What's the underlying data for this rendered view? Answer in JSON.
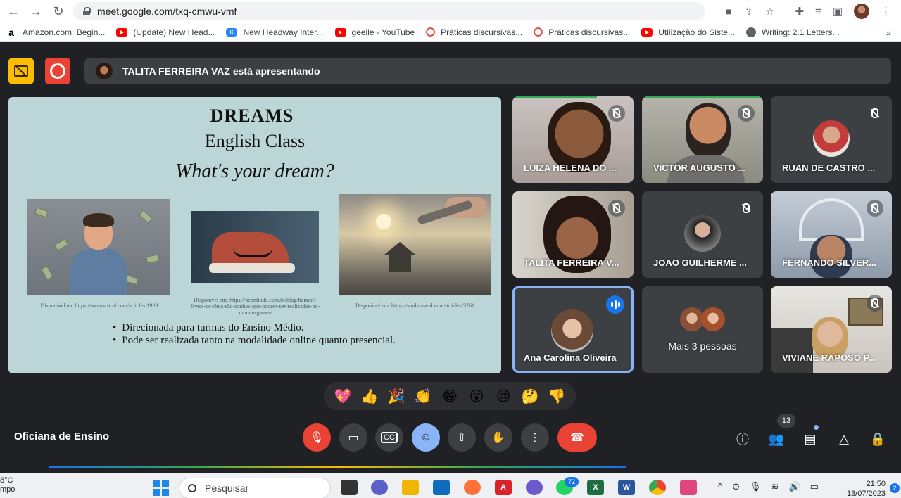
{
  "browser": {
    "url": "meet.google.com/txq-cmwu-vmf",
    "bookmarks": [
      {
        "label": "Amazon.com: Begin...",
        "icon": "amazon-icon"
      },
      {
        "label": "(Update) New Head...",
        "icon": "youtube-icon"
      },
      {
        "label": "New Headway Inter...",
        "icon": "vk-icon"
      },
      {
        "label": "geelle - YouTube",
        "icon": "youtube-icon"
      },
      {
        "label": "Práticas discursivas...",
        "icon": "target-icon"
      },
      {
        "label": "Práticas discursivas...",
        "icon": "target-icon"
      },
      {
        "label": "Utilização do Siste...",
        "icon": "youtube-icon"
      },
      {
        "label": "Writing: 2.1 Letters...",
        "icon": "globe-icon"
      }
    ],
    "more": "»"
  },
  "meet": {
    "presenting_text": "TALITA FERREIRA VAZ está apresentando",
    "meeting_name": "Oficiana de Ensino",
    "people_count": "13"
  },
  "slide": {
    "title": "DREAMS",
    "subtitle": "English Class",
    "question": "What's your dream?",
    "captions": [
      "Disponível em:https://sonhoastral.com/articles/1923",
      "Disponível em: https://oconfiado.com.br/blog/homens-livres-os-tênis-são-sonhos-que-podem-ser-realizados-no-mundo-gamer/",
      "Disponível em: https://sonhoastral.com/articles/3761"
    ],
    "bullets": [
      "Direcionada para turmas do Ensino Médio.",
      "Pode ser realizada tanto na modalidade online quanto presencial."
    ]
  },
  "participants": [
    {
      "name": "LUIZA HELENA DO ..."
    },
    {
      "name": "VICTOR AUGUSTO ..."
    },
    {
      "name": "RUAN DE CASTRO ..."
    },
    {
      "name": "TALITA FERREIRA V..."
    },
    {
      "name": "JOAO GUILHERME ..."
    },
    {
      "name": "FERNANDO SILVER..."
    },
    {
      "name": "Ana Carolina Oliveira"
    },
    {
      "name": "Mais 3 pessoas"
    },
    {
      "name": "VIVIANE RAPOSO P..."
    }
  ],
  "reactions": [
    "💖",
    "👍",
    "🎉",
    "👏",
    "😂",
    "😮",
    "😢",
    "🤔",
    "👎"
  ],
  "taskbar": {
    "weather_temp": "8°C",
    "weather_text": "mpo",
    "search_placeholder": "Pesquisar",
    "whatsapp_badge": "72",
    "time": "21:50",
    "date": "13/07/2023",
    "notifications": "2"
  }
}
